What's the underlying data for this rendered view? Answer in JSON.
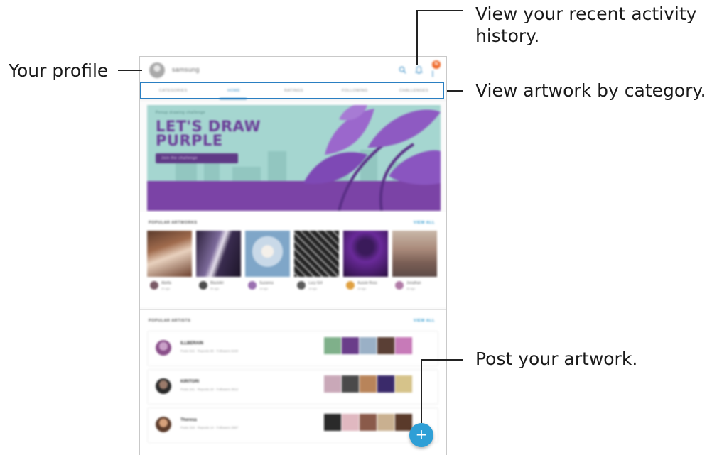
{
  "callouts": {
    "profile": "Your profile",
    "activity_line1": "View your recent activity",
    "activity_line2": "history.",
    "category": "View artwork by category.",
    "post": "Post your artwork."
  },
  "app": {
    "username": "samsung",
    "notification_badge": "N",
    "icons": {
      "search": "search-icon",
      "notifications": "bell-icon",
      "more": "more-options-icon",
      "add": "plus-icon"
    }
  },
  "tabs": [
    {
      "label": "Categories",
      "active": false
    },
    {
      "label": "Home",
      "active": true
    },
    {
      "label": "Ratings",
      "active": false
    },
    {
      "label": "Following",
      "active": false
    },
    {
      "label": "Challenges",
      "active": false
    }
  ],
  "banner": {
    "kicker": "Penup drawing challenge",
    "title_line1": "LET'S DRAW",
    "title_line2": "PURPLE",
    "button": "Join the challenge"
  },
  "popular_artworks": {
    "title": "POPULAR ARTWORKS",
    "link": "VIEW ALL",
    "items": [
      {
        "artist": "Abella",
        "meta": "2h ago",
        "color": "#8a5a44"
      },
      {
        "artist": "BlackArt",
        "meta": "5h ago",
        "color": "#5c4a6e"
      },
      {
        "artist": "Suzanna",
        "meta": "1d ago",
        "color": "#9dbbd4"
      },
      {
        "artist": "Lucy Gril",
        "meta": "1d ago",
        "color": "#333333"
      },
      {
        "artist": "Aussie Ross",
        "meta": "2d ago",
        "color": "#5a2a7a"
      },
      {
        "artist": "Jonathan",
        "meta": "3d ago",
        "color": "#a98a7a"
      }
    ]
  },
  "popular_artists": {
    "title": "POPULAR ARTISTS",
    "link": "VIEW ALL",
    "items": [
      {
        "name": "ILLBERAIN",
        "meta": "Posts 542 · Reposts 88 · Followers 6440"
      },
      {
        "name": "KIRITORI",
        "meta": "Posts 241 · Reposts 20 · Followers 3512"
      },
      {
        "name": "Theresa",
        "meta": "Posts 318 · Reposts 14 · Followers 2987"
      }
    ]
  }
}
